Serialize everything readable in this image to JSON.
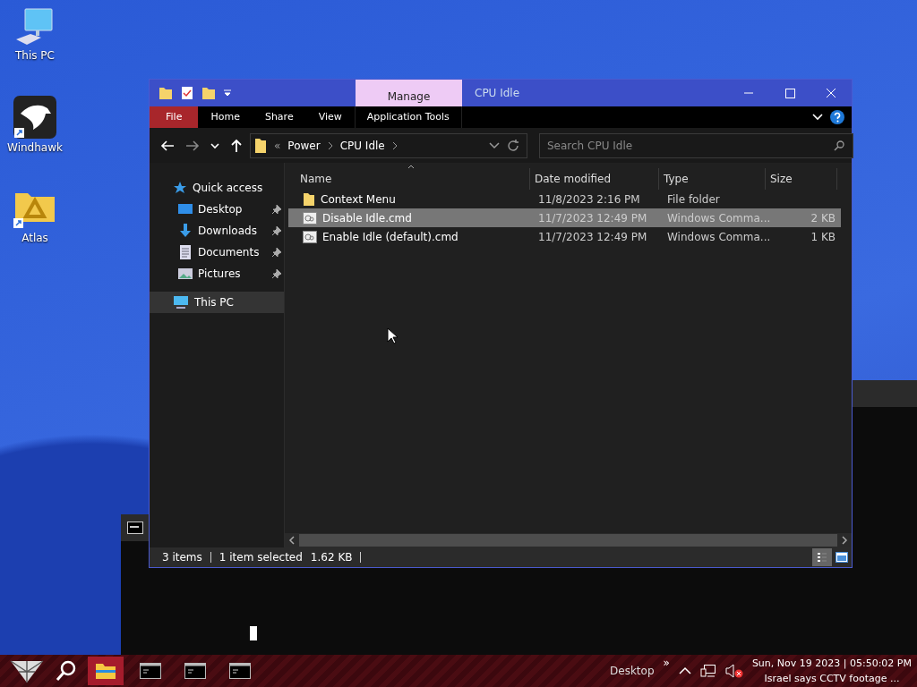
{
  "desktop_icons": [
    {
      "label": "This PC",
      "kind": "pc"
    },
    {
      "label": "Windhawk",
      "kind": "hawk"
    },
    {
      "label": "Atlas",
      "kind": "atlas"
    }
  ],
  "window": {
    "title": "CPU Idle",
    "context_tab": "Manage",
    "ribbon_tabs": [
      {
        "label": "File",
        "kind": "file"
      },
      {
        "label": "Home",
        "kind": "plain"
      },
      {
        "label": "Share",
        "kind": "plain"
      },
      {
        "label": "View",
        "kind": "plain"
      },
      {
        "label": "Application Tools",
        "kind": "context"
      }
    ],
    "address": {
      "overflow": "«",
      "path": [
        "Power",
        "CPU Idle"
      ]
    },
    "search": {
      "placeholder": "Search CPU Idle"
    },
    "nav": [
      {
        "label": "Quick access",
        "kind": "star",
        "selected": false,
        "children": [
          {
            "label": "Desktop",
            "kind": "desktop",
            "pinned": true,
            "selected": false
          },
          {
            "label": "Downloads",
            "kind": "downloads",
            "pinned": true,
            "selected": false
          },
          {
            "label": "Documents",
            "kind": "documents",
            "pinned": true,
            "selected": false
          },
          {
            "label": "Pictures",
            "kind": "pictures",
            "pinned": true,
            "selected": false
          }
        ]
      },
      {
        "label": "This PC",
        "kind": "pc",
        "selected": true
      }
    ],
    "columns": [
      "Name",
      "Date modified",
      "Type",
      "Size"
    ],
    "rows": [
      {
        "name": "Context Menu",
        "date": "11/8/2023 2:16 PM",
        "type": "File folder",
        "size": "",
        "kind": "folder",
        "selected": false
      },
      {
        "name": "Disable Idle.cmd",
        "date": "11/7/2023 12:49 PM",
        "type": "Windows Comma...",
        "size": "2 KB",
        "kind": "script",
        "selected": true
      },
      {
        "name": "Enable Idle (default).cmd",
        "date": "11/7/2023 12:49 PM",
        "type": "Windows Comma...",
        "size": "1 KB",
        "kind": "script",
        "selected": false
      }
    ],
    "status": [
      "3 items",
      "1 item selected",
      "1.62 KB"
    ],
    "view_buttons": [
      {
        "kind": "details",
        "selected": true
      },
      {
        "kind": "large",
        "selected": false
      }
    ]
  },
  "taskbar": {
    "apps": [
      {
        "kind": "explorer",
        "active": true
      },
      {
        "kind": "console",
        "active": false
      },
      {
        "kind": "console",
        "active": false
      },
      {
        "kind": "console",
        "active": false
      }
    ],
    "desktop_label": "Desktop",
    "overflow": "»",
    "clock": "Sun, Nov 19 2023 | 05:50:02 PM",
    "news": "Israel says CCTV footage ..."
  }
}
